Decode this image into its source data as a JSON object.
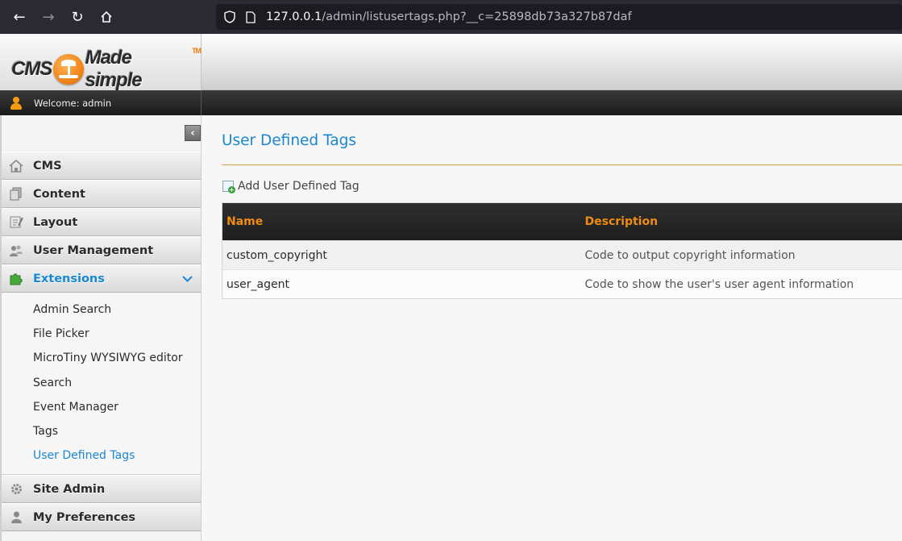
{
  "browser": {
    "url_host": "127.0.0.1",
    "url_path": "/admin/listusertags.php?__c=25898db73a327b87daf"
  },
  "brand": {
    "logo_left": "CMS",
    "logo_right": "Made simple",
    "logo_tm": "TM",
    "accent_color": "#ee7d10"
  },
  "topbar": {
    "welcome": "Welcome: admin"
  },
  "sidebar": {
    "collapse_glyph": "‹",
    "items": [
      {
        "label": "CMS",
        "icon": "house-icon"
      },
      {
        "label": "Content",
        "icon": "pages-icon"
      },
      {
        "label": "Layout",
        "icon": "layout-icon"
      },
      {
        "label": "User Management",
        "icon": "users-icon"
      },
      {
        "label": "Extensions",
        "icon": "puzzle-icon",
        "active": true
      },
      {
        "label": "Site Admin",
        "icon": "gear-icon"
      },
      {
        "label": "My Preferences",
        "icon": "user-icon"
      }
    ],
    "submenu": [
      {
        "label": "Admin Search"
      },
      {
        "label": "File Picker"
      },
      {
        "label": "MicroTiny WYSIWYG editor"
      },
      {
        "label": "Search"
      },
      {
        "label": "Event Manager"
      },
      {
        "label": "Tags"
      },
      {
        "label": "User Defined Tags",
        "active": true
      }
    ]
  },
  "main": {
    "title": "User Defined Tags",
    "add_label": "Add User Defined Tag",
    "table": {
      "columns": [
        "Name",
        "Description"
      ],
      "rows": [
        {
          "name": "custom_copyright",
          "description": "Code to output copyright information"
        },
        {
          "name": "user_agent",
          "description": "Code to show the user's user agent information"
        }
      ]
    }
  }
}
